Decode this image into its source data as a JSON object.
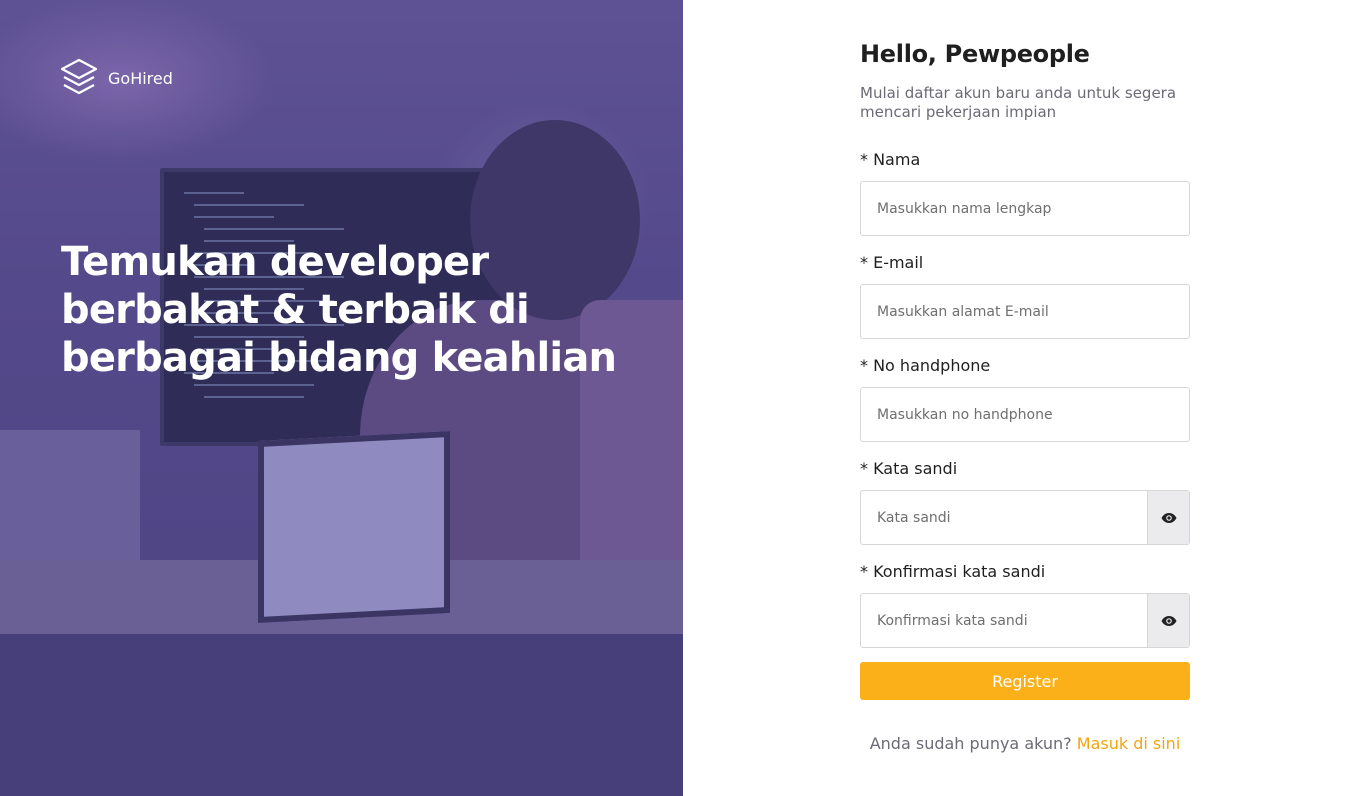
{
  "brand": {
    "name": "GoHired",
    "logo_icon": "layers-icon"
  },
  "hero": {
    "headline": "Temukan developer berbakat & terbaik di berbagai bidang keahlian"
  },
  "form": {
    "title": "Hello, Pewpeople",
    "subtitle": "Mulai daftar akun baru anda untuk segera mencari pekerjaan impian",
    "fields": [
      {
        "label": "* Nama",
        "placeholder": "Masukkan nama lengkap"
      },
      {
        "label": "* E-mail",
        "placeholder": "Masukkan alamat E-mail"
      },
      {
        "label": "* No handphone",
        "placeholder": "Masukkan no handphone"
      },
      {
        "label": "* Kata sandi",
        "placeholder": "Kata sandi",
        "icon": "eye-icon"
      },
      {
        "label": "* Konfirmasi kata sandi",
        "placeholder": "Konfirmasi kata sandi",
        "icon": "eye-icon"
      }
    ],
    "register_label": "Register",
    "footer_text": "Anda sudah punya akun?",
    "footer_link": "Masuk di sini"
  },
  "colors": {
    "left_panel": "#473f7a",
    "accent": "#fbb019",
    "link": "#f2a514"
  }
}
